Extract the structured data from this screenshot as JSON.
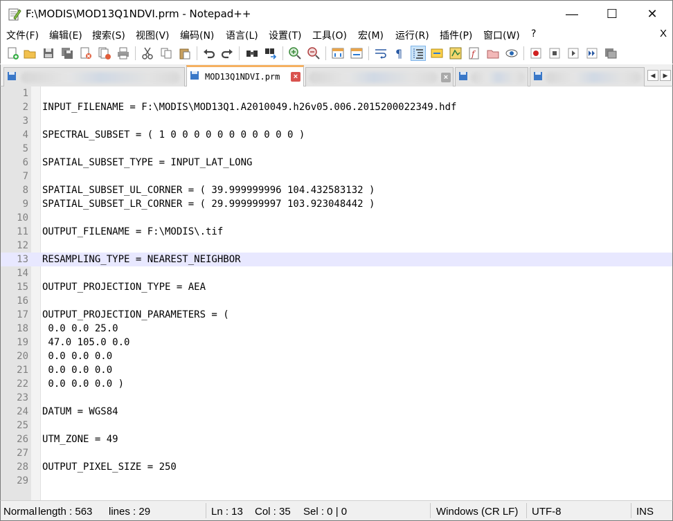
{
  "window": {
    "title": "F:\\MODIS\\MOD13Q1NDVI.prm - Notepad++",
    "minimize_glyph": "—",
    "maximize_glyph": "☐",
    "close_glyph": "✕"
  },
  "menu": {
    "items": [
      "文件(F)",
      "编辑(E)",
      "搜索(S)",
      "视图(V)",
      "编码(N)",
      "语言(L)",
      "设置(T)",
      "工具(O)",
      "宏(M)",
      "运行(R)",
      "插件(P)",
      "窗口(W)",
      "?"
    ],
    "close_label": "X"
  },
  "toolbar": {
    "icons": [
      "new-file-icon",
      "open-file-icon",
      "save-icon",
      "save-all-icon",
      "close-icon",
      "close-all-icon",
      "print-icon",
      "cut-icon",
      "copy-icon",
      "paste-icon",
      "undo-icon",
      "redo-icon",
      "find-icon",
      "replace-icon",
      "zoom-in-icon",
      "zoom-out-icon",
      "sync-vertical-icon",
      "sync-horizontal-icon",
      "word-wrap-icon",
      "show-all-chars-icon",
      "indent-guide-icon",
      "user-language-icon",
      "document-map-icon",
      "function-list-icon",
      "folder-workspace-icon",
      "monitor-icon",
      "record-macro-icon",
      "stop-macro-icon",
      "play-macro-icon",
      "run-macro-multiple-icon",
      "save-macro-icon"
    ]
  },
  "tabs": {
    "active_label": "MOD13Q1NDVI.prm",
    "close_glyph": "×"
  },
  "editor": {
    "current_line": 13,
    "lines": [
      "",
      "INPUT_FILENAME = F:\\MODIS\\MOD13Q1.A2010049.h26v05.006.2015200022349.hdf",
      "",
      "SPECTRAL_SUBSET = ( 1 0 0 0 0 0 0 0 0 0 0 0 )",
      "",
      "SPATIAL_SUBSET_TYPE = INPUT_LAT_LONG",
      "",
      "SPATIAL_SUBSET_UL_CORNER = ( 39.999999996 104.432583132 )",
      "SPATIAL_SUBSET_LR_CORNER = ( 29.999999997 103.923048442 )",
      "",
      "OUTPUT_FILENAME = F:\\MODIS\\.tif",
      "",
      "RESAMPLING_TYPE = NEAREST_NEIGHBOR",
      "",
      "OUTPUT_PROJECTION_TYPE = AEA",
      "",
      "OUTPUT_PROJECTION_PARAMETERS = (",
      " 0.0 0.0 25.0",
      " 47.0 105.0 0.0",
      " 0.0 0.0 0.0",
      " 0.0 0.0 0.0",
      " 0.0 0.0 0.0 )",
      "",
      "DATUM = WGS84",
      "",
      "UTM_ZONE = 49",
      "",
      "OUTPUT_PIXEL_SIZE = 250",
      ""
    ]
  },
  "status": {
    "doc_type": "Normal text file",
    "length": "length : 563",
    "lines": "lines : 29",
    "ln": "Ln : 13",
    "col": "Col : 35",
    "sel": "Sel : 0 | 0",
    "eol": "Windows (CR LF)",
    "encoding": "UTF-8",
    "mode": "INS"
  }
}
